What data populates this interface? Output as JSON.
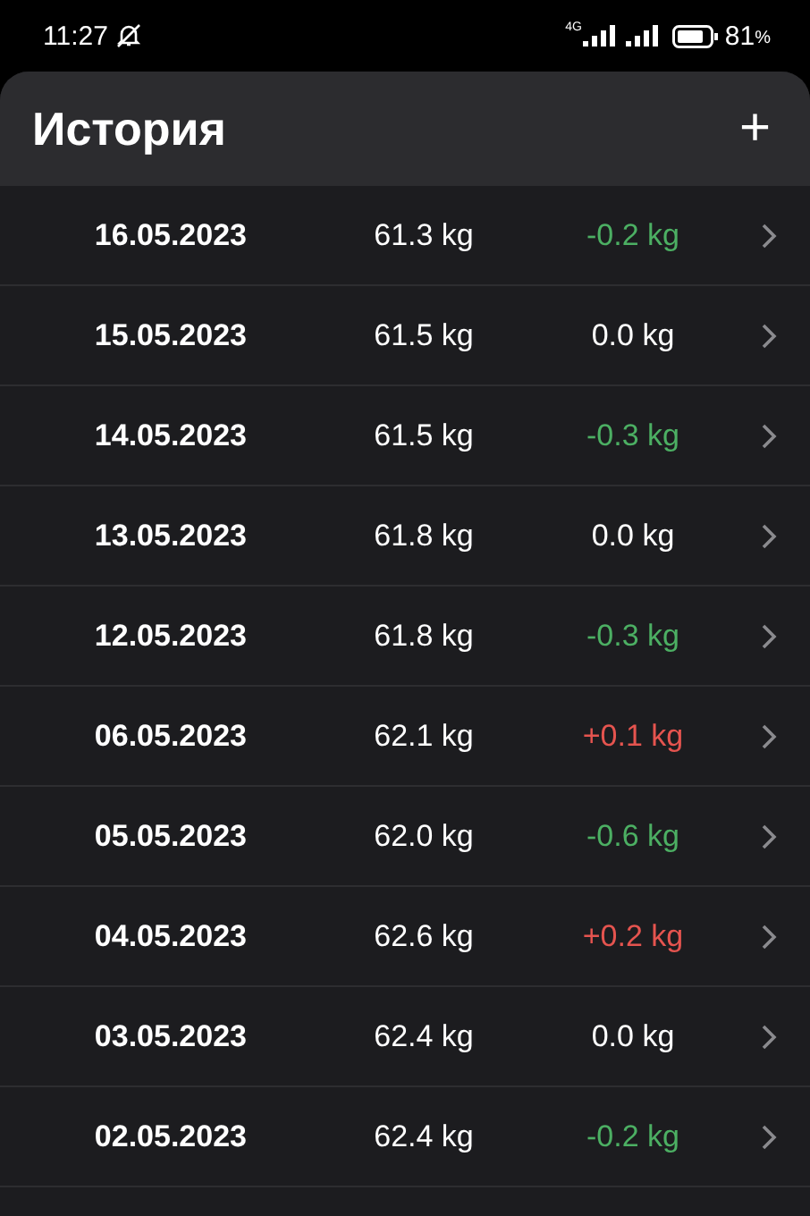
{
  "status_bar": {
    "time": "11:27",
    "network": "4G",
    "battery": "81",
    "battery_unit": "%"
  },
  "header": {
    "title": "История",
    "add_button": "+"
  },
  "entries": [
    {
      "date": "16.05.2023",
      "weight": "61.3 kg",
      "change": "-0.2 kg",
      "color": "#4caf63"
    },
    {
      "date": "15.05.2023",
      "weight": "61.5 kg",
      "change": "0.0 kg",
      "color": "#ffffff"
    },
    {
      "date": "14.05.2023",
      "weight": "61.5 kg",
      "change": "-0.3 kg",
      "color": "#4caf63"
    },
    {
      "date": "13.05.2023",
      "weight": "61.8 kg",
      "change": "0.0 kg",
      "color": "#ffffff"
    },
    {
      "date": "12.05.2023",
      "weight": "61.8 kg",
      "change": "-0.3 kg",
      "color": "#4caf63"
    },
    {
      "date": "06.05.2023",
      "weight": "62.1 kg",
      "change": "+0.1 kg",
      "color": "#e5544f"
    },
    {
      "date": "05.05.2023",
      "weight": "62.0 kg",
      "change": "-0.6 kg",
      "color": "#4caf63"
    },
    {
      "date": "04.05.2023",
      "weight": "62.6 kg",
      "change": "+0.2 kg",
      "color": "#e5544f"
    },
    {
      "date": "03.05.2023",
      "weight": "62.4 kg",
      "change": "0.0 kg",
      "color": "#ffffff"
    },
    {
      "date": "02.05.2023",
      "weight": "62.4 kg",
      "change": "-0.2 kg",
      "color": "#4caf63"
    }
  ]
}
